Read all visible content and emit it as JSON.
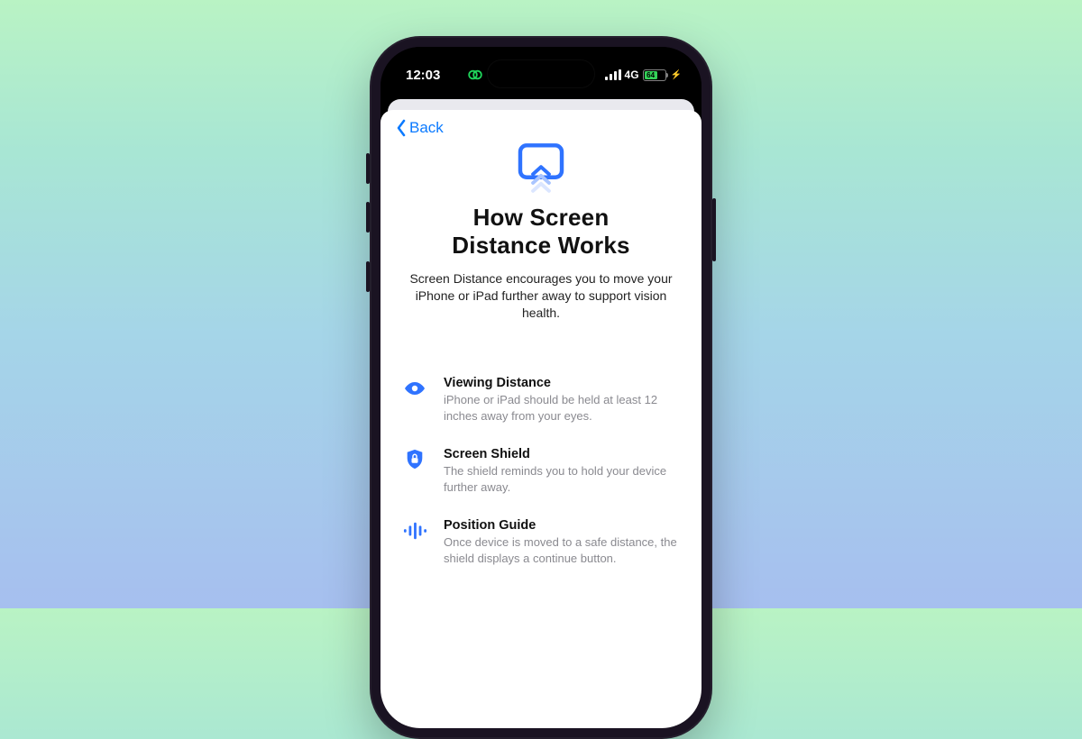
{
  "statusbar": {
    "time": "12:03",
    "network_label": "4G",
    "battery_percent": "64",
    "charging_glyph": "⚡"
  },
  "nav": {
    "back_label": "Back"
  },
  "hero": {
    "title": "How Screen\nDistance Works",
    "description": "Screen Distance encourages you to move your iPhone or iPad further away to support vision health."
  },
  "features": [
    {
      "icon": "eye-icon",
      "title": "Viewing Distance",
      "desc": "iPhone or iPad should be held at least 12 inches away from your eyes."
    },
    {
      "icon": "shield-lock-icon",
      "title": "Screen Shield",
      "desc": "The shield reminds you to hold your device further away."
    },
    {
      "icon": "waveform-icon",
      "title": "Position Guide",
      "desc": "Once device is moved to a safe distance, the shield displays a continue button."
    }
  ],
  "colors": {
    "accent": "#0b7aff",
    "feature_blue": "#2f73ff"
  }
}
